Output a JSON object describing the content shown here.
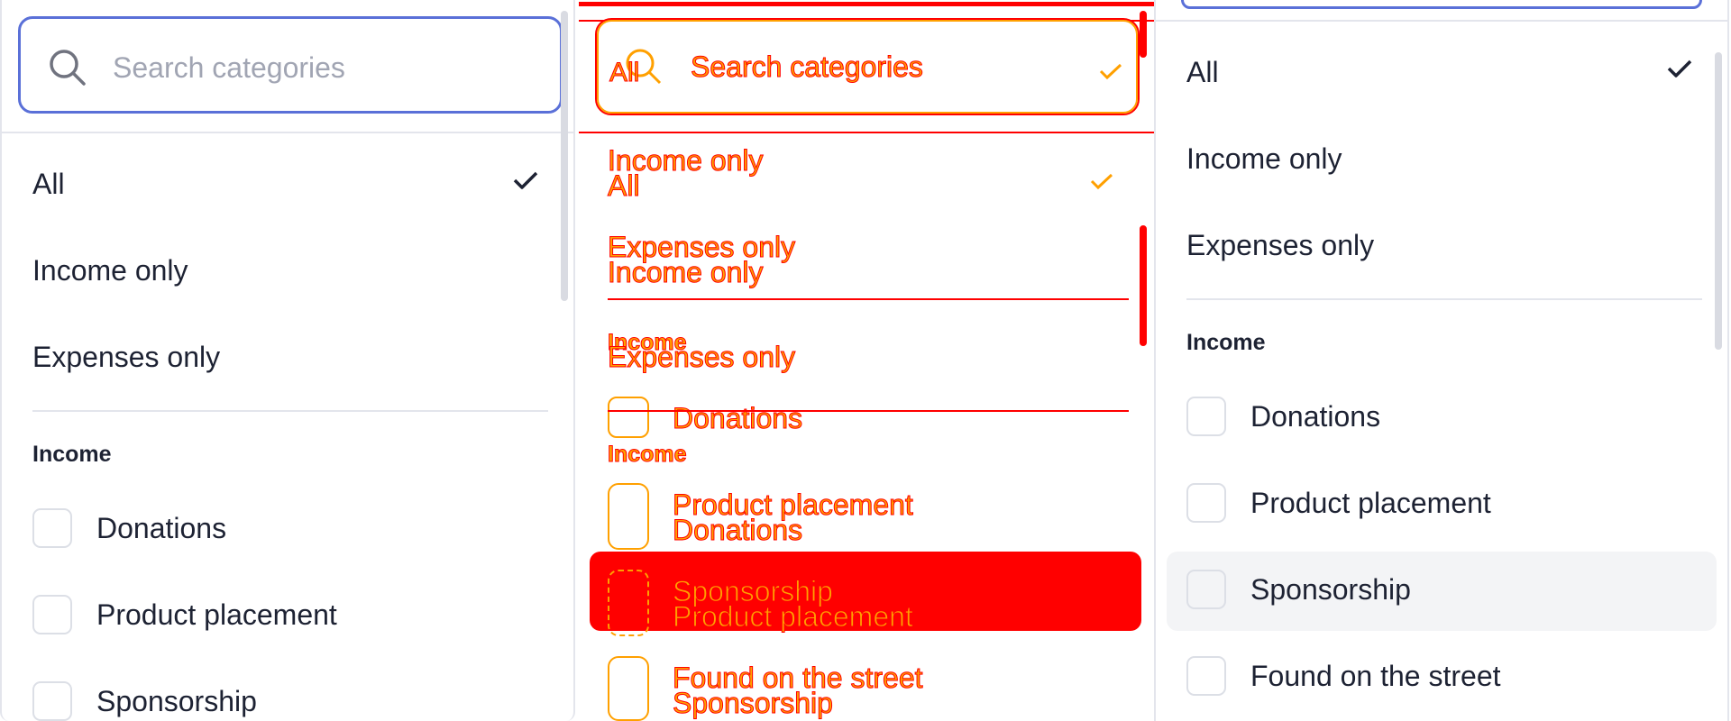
{
  "search": {
    "placeholder": "Search categories"
  },
  "options": {
    "all": "All",
    "income_only": "Income only",
    "expenses_only": "Expenses only"
  },
  "groups": {
    "income": "Income"
  },
  "income_items": [
    "Donations",
    "Product placement",
    "Sponsorship",
    "Found on the street"
  ],
  "colors": {
    "accent": "#5a70d8",
    "text": "#1d2233",
    "placeholder": "#a1a5b3",
    "border": "#e3e5ec",
    "debug_red": "#ff0000",
    "debug_orange": "#ffa000",
    "hover_bg": "#f3f4f6"
  }
}
